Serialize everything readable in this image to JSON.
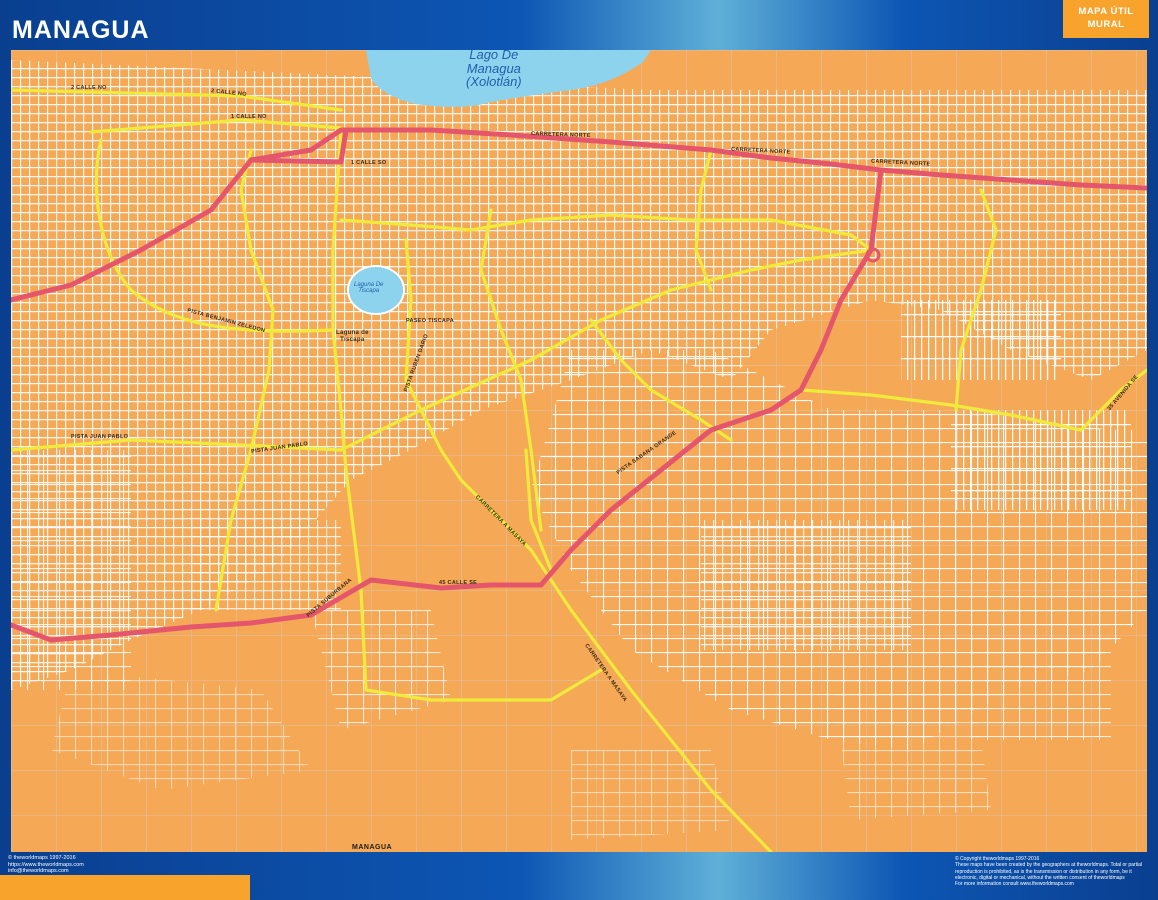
{
  "header": {
    "title": "MANAGUA",
    "brand_line1": "MAPA ÚTIL",
    "brand_line2": "MURAL"
  },
  "map": {
    "colors": {
      "land": "#f5a855",
      "water": "#8ed3ee",
      "local_streets": "#ffffff",
      "main_roads": "#f0ea3c",
      "highways": "#e4566b",
      "frame": "#0d56b4",
      "accent": "#f7a32c"
    },
    "water": {
      "lake_line1": "Lago De",
      "lake_line2": "Managua",
      "lake_line3": "(Xolotlán)",
      "lagoon_line1": "Laguna De",
      "lagoon_line2": "Tiscapa"
    },
    "places": {
      "laguna_tiscapa_line1": "Laguna de",
      "laguna_tiscapa_line2": "Tiscapa",
      "bottom_city": "MANAGUA"
    },
    "roads": {
      "calle_no_1": "2 CALLE NO",
      "calle_no_2": "2 CALLE NO",
      "calle_no_3": "1 CALLE NO",
      "calle_so": "1 CALLE SO",
      "carretera_norte_1": "CARRETERA NORTE",
      "carretera_norte_2": "CARRETERA NORTE",
      "carretera_norte_3": "CARRETERA NORTE",
      "pista_juan_pablo_1": "PISTA JUAN PABLO",
      "pista_juan_pablo_2": "PISTA JUAN PABLO",
      "paseo_tiscapa": "PASEO TISCAPA",
      "pista_benjamin": "PISTA BENJAMIN ZELEDON",
      "pista_ruben_dario": "PISTA RUBEN DARIO",
      "calle_45": "45 CALLE SE",
      "carretera_masaya": "CARRETERA A MASAYA",
      "carretera_masaya_2": "CARRETERA A MASAYA",
      "pista_sabana": "PISTA SABANA GRANDE",
      "pista_suburbana": "PISTA SUBURBANA",
      "avenida_se": "35 AVENIDA SE"
    }
  },
  "footer": {
    "left_line1": "© theworldmaps 1997-2016",
    "left_line2": "https://www.theworldmaps.com",
    "left_line3": "info@theworldmaps.com",
    "right_line1": "© Copyright theworldmaps 1997-2016",
    "right_line2": "These maps have been created by the geographers at theworldmaps. Total or partial",
    "right_line3": "reproduction is prohibited, as is the transmission or distribution in any form, be it",
    "right_line4": "electronic, digital or mechanical, without the written consent of theworldmaps",
    "right_line5": "For more information consult www.theworldmaps.com"
  }
}
